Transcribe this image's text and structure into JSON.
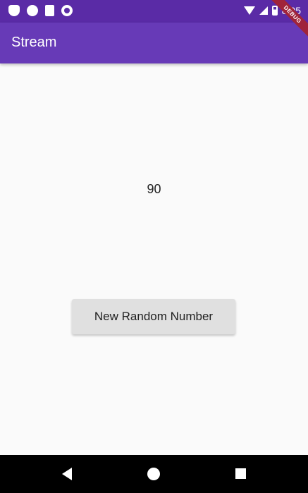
{
  "status_bar": {
    "time": "8:05",
    "left_icons": [
      "shield-icon",
      "compass-icon",
      "sd-card-icon",
      "ring-icon"
    ],
    "right_icons": [
      "wifi-icon",
      "signal-icon",
      "battery-icon"
    ]
  },
  "app_bar": {
    "title": "Stream",
    "color": "#673ab7"
  },
  "debug_banner": "DEBUG",
  "main": {
    "number": "90",
    "button_label": "New Random Number"
  },
  "nav_bar": {
    "icons": [
      "back-icon",
      "home-icon",
      "recents-icon"
    ]
  }
}
